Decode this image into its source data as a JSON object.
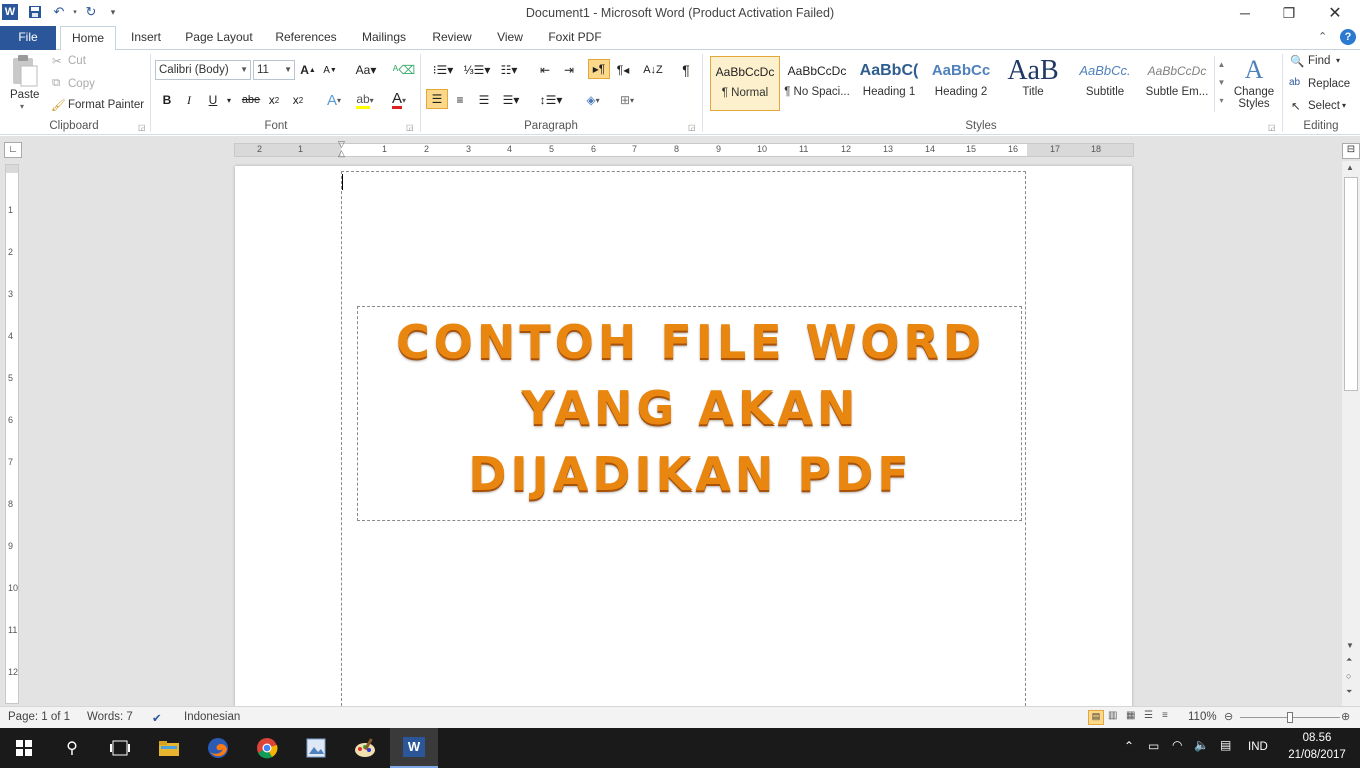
{
  "window": {
    "title": "Document1  -  Microsoft Word (Product Activation Failed)"
  },
  "tabs": [
    {
      "label": "File"
    },
    {
      "label": "Home"
    },
    {
      "label": "Insert"
    },
    {
      "label": "Page Layout"
    },
    {
      "label": "References"
    },
    {
      "label": "Mailings"
    },
    {
      "label": "Review"
    },
    {
      "label": "View"
    },
    {
      "label": "Foxit PDF"
    }
  ],
  "clipboard": {
    "paste": "Paste",
    "cut": "Cut",
    "copy": "Copy",
    "format_painter": "Format Painter",
    "group": "Clipboard"
  },
  "font": {
    "name": "Calibri (Body)",
    "size": "11",
    "group": "Font"
  },
  "paragraph": {
    "group": "Paragraph"
  },
  "styles": {
    "group": "Styles",
    "items": [
      {
        "sample": "AaBbCcDc",
        "name": "¶ Normal"
      },
      {
        "sample": "AaBbCcDc",
        "name": "¶ No Spaci..."
      },
      {
        "sample": "AaBbC(",
        "name": "Heading 1"
      },
      {
        "sample": "AaBbCc",
        "name": "Heading 2"
      },
      {
        "sample": "AaB",
        "name": "Title"
      },
      {
        "sample": "AaBbCc.",
        "name": "Subtitle"
      },
      {
        "sample": "AaBbCcDc",
        "name": "Subtle Em..."
      }
    ],
    "change_line1": "Change",
    "change_line2": "Styles"
  },
  "editing": {
    "group": "Editing",
    "find": "Find",
    "replace": "Replace",
    "select": "Select"
  },
  "ruler": {
    "h_numbers": [
      "2",
      "1",
      "1",
      "2",
      "3",
      "4",
      "5",
      "6",
      "7",
      "8",
      "9",
      "10",
      "11",
      "12",
      "13",
      "14",
      "15",
      "16",
      "17",
      "18"
    ],
    "v_numbers": [
      "1",
      "2",
      "3",
      "4",
      "5",
      "6",
      "7",
      "8",
      "9",
      "10",
      "11",
      "12"
    ]
  },
  "document": {
    "wordart_lines": [
      "CONTOH FILE WORD",
      "YANG AKAN",
      "DIJADIKAN PDF"
    ]
  },
  "status": {
    "page": "Page: 1 of 1",
    "words": "Words: 7",
    "language": "Indonesian",
    "zoom": "110%"
  },
  "taskbar": {
    "lang": "IND",
    "time": "08.56",
    "date": "21/08/2017"
  },
  "colors": {
    "accent": "#2b579a",
    "wordart": "#e8860f"
  }
}
